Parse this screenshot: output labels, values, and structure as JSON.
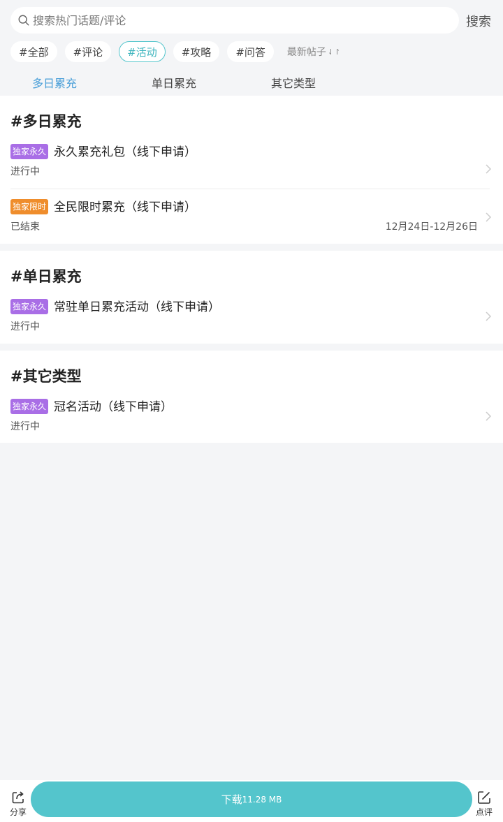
{
  "search": {
    "placeholder": "搜索热门话题/评论",
    "button_label": "搜索"
  },
  "tags": [
    {
      "label": "#全部",
      "active": false
    },
    {
      "label": "#评论",
      "active": false
    },
    {
      "label": "#活动",
      "active": true
    },
    {
      "label": "#攻略",
      "active": false
    },
    {
      "label": "#问答",
      "active": false
    }
  ],
  "sort": {
    "label": "最新帖子",
    "icon": "sort-arrows-icon"
  },
  "category_tabs": [
    {
      "label": "多日累充",
      "active": true
    },
    {
      "label": "单日累充",
      "active": false
    },
    {
      "label": "其它类型",
      "active": false
    }
  ],
  "sections": [
    {
      "title": "#多日累充",
      "items": [
        {
          "badge": "独家永久",
          "badge_color": "#a96ee6",
          "title": "永久累充礼包（线下申请）",
          "status": "进行中",
          "date": ""
        },
        {
          "badge": "独家限时",
          "badge_color": "#ef8d2c",
          "title": "全民限时累充（线下申请）",
          "status": "已结束",
          "date": "12月24日-12月26日"
        }
      ]
    },
    {
      "title": "#单日累充",
      "items": [
        {
          "badge": "独家永久",
          "badge_color": "#a96ee6",
          "title": "常驻单日累充活动（线下申请）",
          "status": "进行中",
          "date": ""
        }
      ]
    },
    {
      "title": "#其它类型",
      "items": [
        {
          "badge": "独家永久",
          "badge_color": "#a96ee6",
          "title": "冠名活动（线下申请）",
          "status": "进行中",
          "date": ""
        }
      ]
    }
  ],
  "bottom_bar": {
    "share_label": "分享",
    "download_label": "下载",
    "download_size": "11.28 MB",
    "review_label": "点评"
  },
  "colors": {
    "accent": "#54c5cc",
    "tab_active": "#4a9fd8",
    "badge_permanent": "#a96ee6",
    "badge_limited": "#ef8d2c"
  }
}
